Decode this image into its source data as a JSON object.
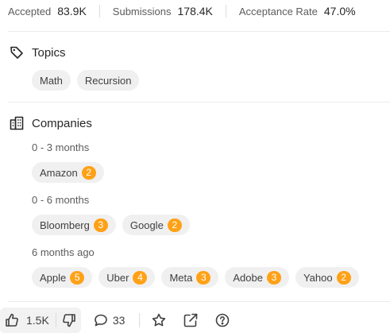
{
  "stats": [
    {
      "label": "Accepted",
      "value": "83.9K"
    },
    {
      "label": "Submissions",
      "value": "178.4K"
    },
    {
      "label": "Acceptance Rate",
      "value": "47.0%"
    }
  ],
  "topics": {
    "title": "Topics",
    "icon": "tag-icon",
    "tags": [
      "Math",
      "Recursion"
    ]
  },
  "companies": {
    "title": "Companies",
    "icon": "building-icon",
    "groups": [
      {
        "period": "0 - 3 months",
        "items": [
          {
            "name": "Amazon",
            "count": "2"
          }
        ]
      },
      {
        "period": "0 - 6 months",
        "items": [
          {
            "name": "Bloomberg",
            "count": "3"
          },
          {
            "name": "Google",
            "count": "2"
          }
        ]
      },
      {
        "period": "6 months ago",
        "items": [
          {
            "name": "Apple",
            "count": "5"
          },
          {
            "name": "Uber",
            "count": "4"
          },
          {
            "name": "Meta",
            "count": "3"
          },
          {
            "name": "Adobe",
            "count": "3"
          },
          {
            "name": "Yahoo",
            "count": "2"
          }
        ]
      }
    ]
  },
  "footer": {
    "likes": "1.5K",
    "comments": "33",
    "icons": [
      "thumbs-up-icon",
      "thumbs-down-icon",
      "comment-icon",
      "star-icon",
      "share-icon",
      "help-icon"
    ]
  },
  "colors": {
    "badge": "#ffa116",
    "chip_bg": "#f0f0f0",
    "vote_bg": "#f2f2f2"
  }
}
